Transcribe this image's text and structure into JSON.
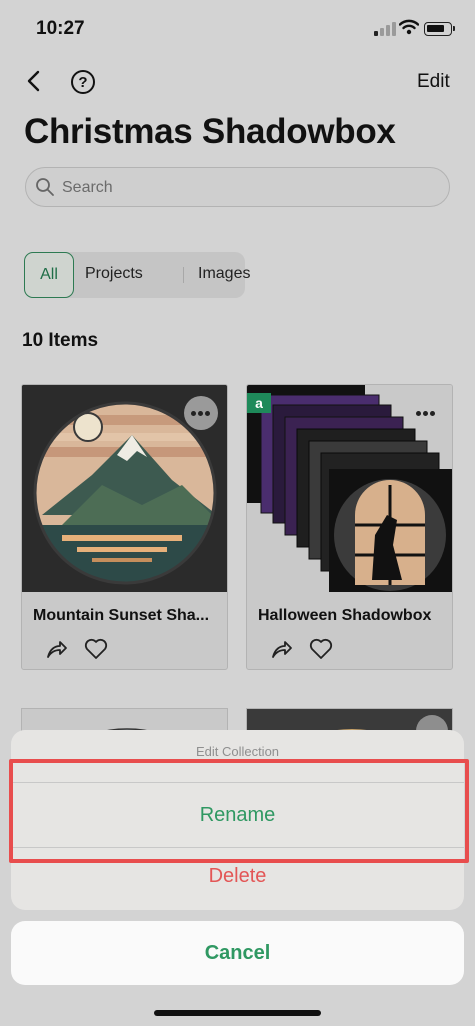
{
  "status_bar": {
    "time": "10:27"
  },
  "header": {
    "edit_label": "Edit",
    "title": "Christmas Shadowbox"
  },
  "search": {
    "placeholder": "Search"
  },
  "filters": {
    "all": "All",
    "projects": "Projects",
    "images": "Images"
  },
  "items_count": "10 Items",
  "cards": [
    {
      "name": "Mountain Sunset Sha..."
    },
    {
      "name": "Halloween Shadowbox",
      "badge": "a"
    }
  ],
  "action_sheet": {
    "header": "Edit Collection",
    "rename": "Rename",
    "delete": "Delete",
    "cancel": "Cancel"
  },
  "colors": {
    "accent": "#2f9862",
    "danger": "#e35656",
    "highlight": "#e84d4d"
  }
}
